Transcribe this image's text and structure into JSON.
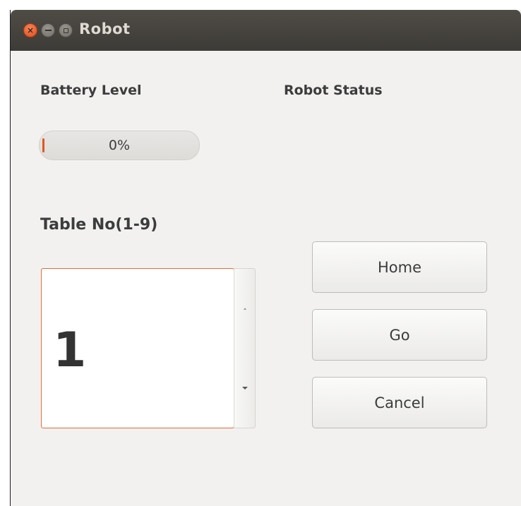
{
  "window": {
    "title": "Robot",
    "controls": {
      "close_glyph": "×"
    }
  },
  "battery": {
    "label": "Battery Level",
    "progress_text": "0%",
    "value_percent": 0,
    "fill_color": "#e0581f"
  },
  "robot_status": {
    "label": "Robot Status"
  },
  "table": {
    "label": "Table No(1-9)",
    "value": "1",
    "min": 1,
    "max": 9
  },
  "buttons": {
    "home": "Home",
    "go": "Go",
    "cancel": "Cancel"
  },
  "colors": {
    "accent": "#e26c35",
    "titlebar": "#3d3b37",
    "window_bg": "#f2f1f0"
  }
}
